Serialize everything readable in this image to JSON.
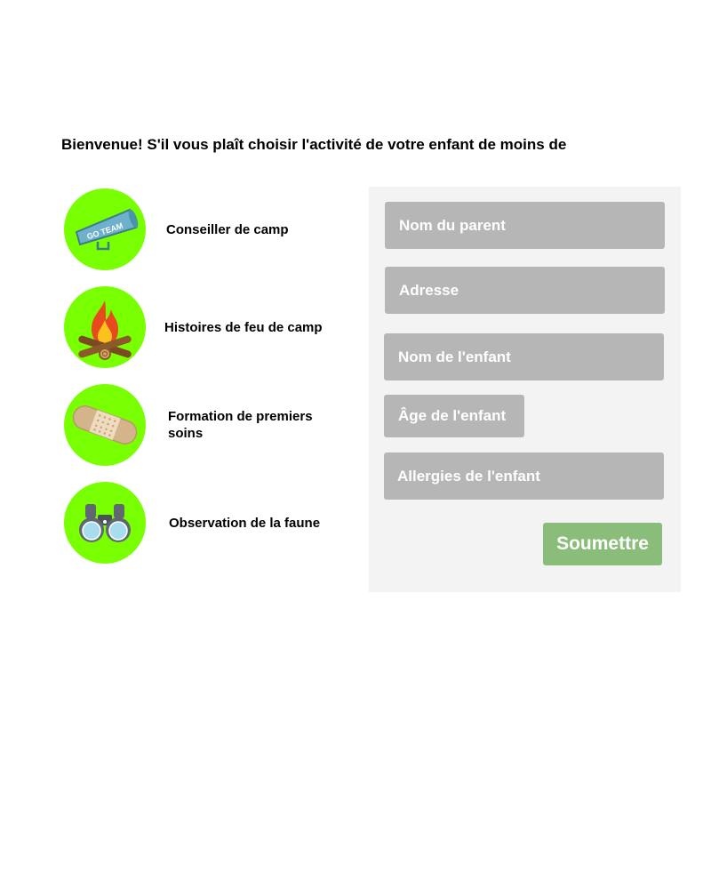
{
  "heading": "Bienvenue! S'il vous plaît choisir l'activité de votre enfant de moins de",
  "activities": [
    {
      "label": "Conseiller de camp",
      "icon": "megaphone-icon",
      "icon_text": "GO TEAM"
    },
    {
      "label": "Histoires de feu de camp",
      "icon": "campfire-icon"
    },
    {
      "label": "Formation de premiers soins",
      "icon": "bandage-icon"
    },
    {
      "label": "Observation de la faune",
      "icon": "binoculars-icon"
    }
  ],
  "form": {
    "parent_name": "Nom du parent",
    "address": "Adresse",
    "child_name": "Nom de l'enfant",
    "child_age": "Âge de l'enfant",
    "child_allergies": "Allergies de l'enfant",
    "submit_label": "Soumettre"
  },
  "colors": {
    "circle": "#78ff00",
    "field": "#b6b6b6",
    "panel": "#f3f3f3",
    "submit": "#8bbd7a"
  }
}
